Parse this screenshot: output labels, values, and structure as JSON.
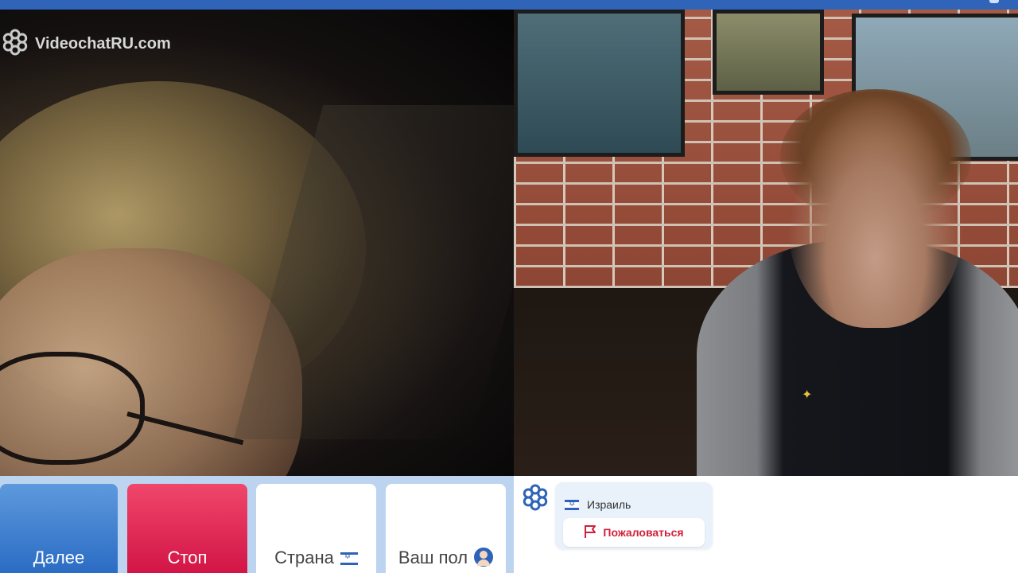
{
  "brand": {
    "name": "VideochatRU.com"
  },
  "controls": {
    "next_label": "Далее",
    "stop_label": "Стоп",
    "country_label": "Страна",
    "gender_label": "Ваш пол"
  },
  "partner": {
    "country": "Израиль",
    "report_label": "Пожаловаться"
  },
  "icons": {
    "logo": "flower-logo-icon",
    "flag": "israel-flag-icon",
    "avatar": "avatar-icon",
    "report": "flag-outline-icon"
  },
  "colors": {
    "accent_blue": "#2f64b8",
    "next_button": "#3b7fd0",
    "stop_button": "#e0305a",
    "report_text": "#d0213a",
    "controls_bg": "#bcd4ef"
  }
}
